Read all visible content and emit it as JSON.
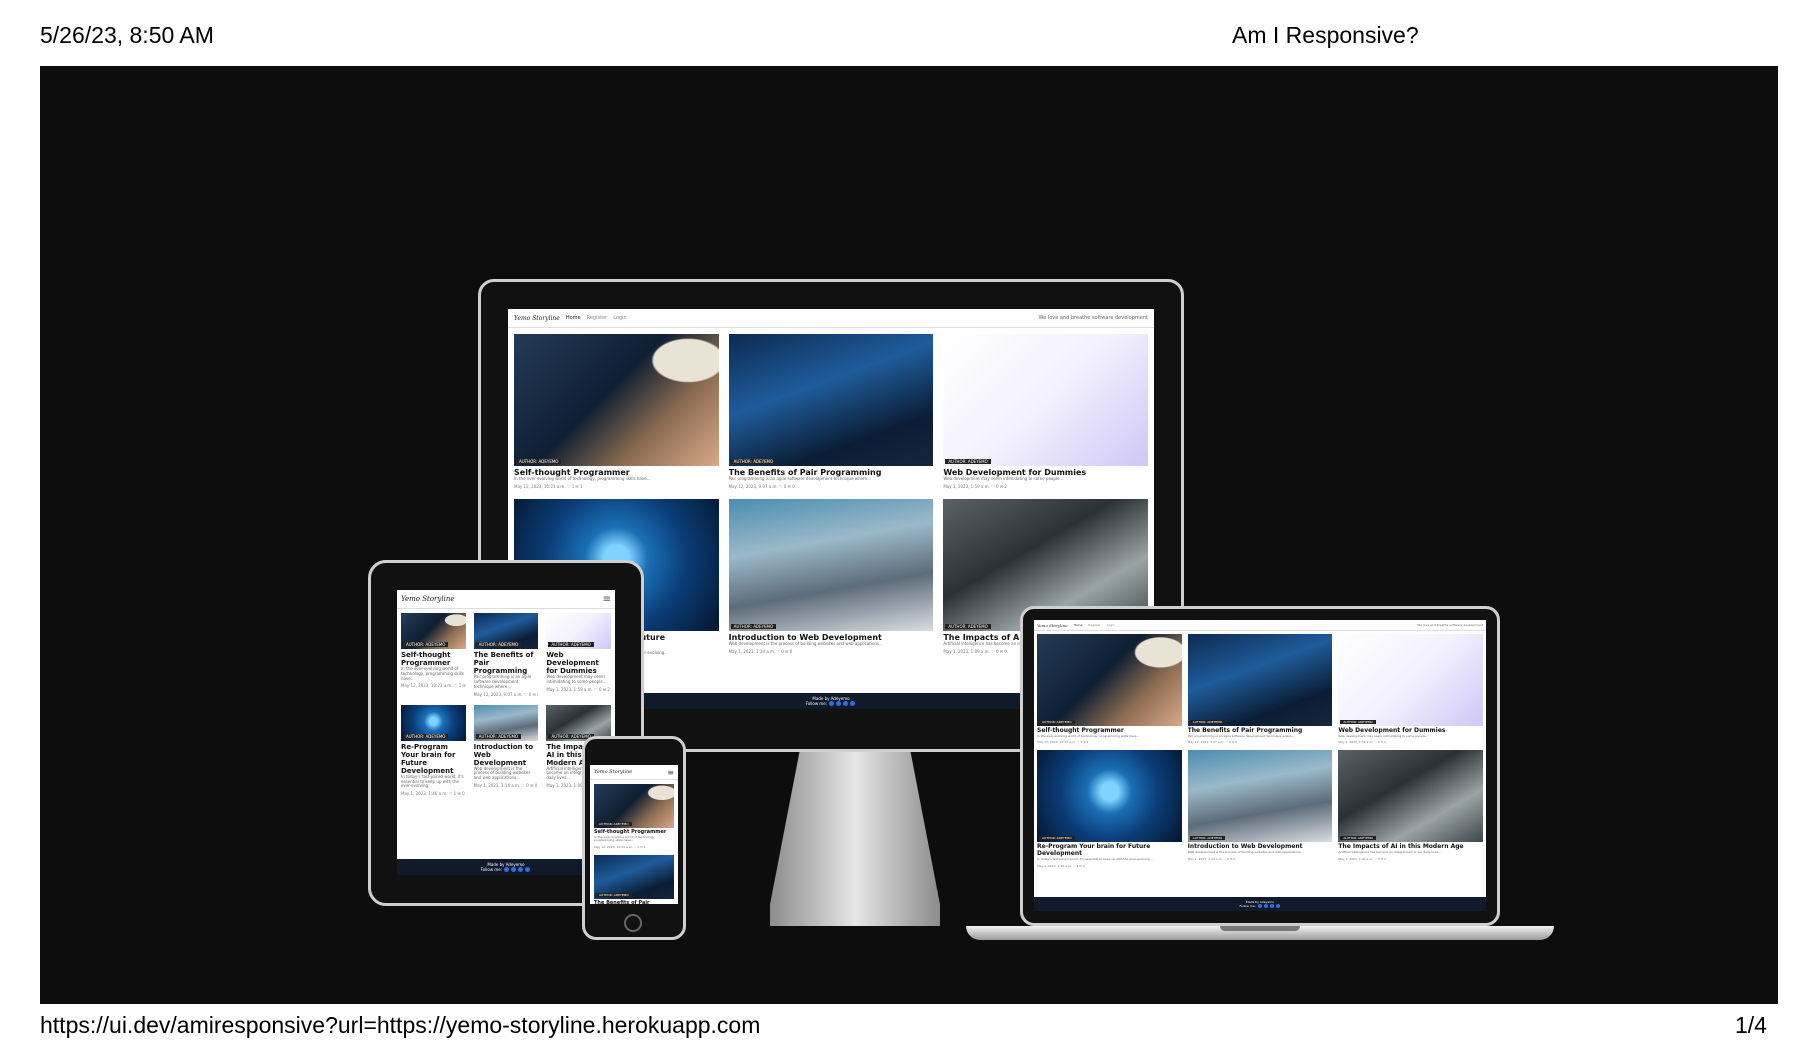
{
  "page_header": {
    "datetime": "5/26/23, 8:50 AM",
    "title": "Am I Responsive?"
  },
  "page_footer": {
    "url": "https://ui.dev/amiresponsive?url=https://yemo-storyline.herokuapp.com",
    "page_number": "1/4"
  },
  "site": {
    "logo": "Yemo Storyline",
    "nav": [
      "Home",
      "Register",
      "Login"
    ],
    "tagline": "We love and breathe software development",
    "footer_made_by": "Made by Adeyemo",
    "footer_follow": "Follow me:"
  },
  "posts": [
    {
      "title": "Self-thought Programmer",
      "badge": "AUTHOR: ADEYEMO",
      "excerpt": "In the ever-evolving world of technology, programming skills have...",
      "date": "May 12, 2023, 10:23 a.m.",
      "likes": "1",
      "comments": "1",
      "thumb": "laptop"
    },
    {
      "title": "The Benefits of Pair Programming",
      "badge": "AUTHOR: ADEYEMO",
      "excerpt": "Pair programming is an agile software development technique where...",
      "date": "May 12, 2023, 9:07 a.m.",
      "likes": "0",
      "comments": "0",
      "thumb": "pair"
    },
    {
      "title": "Web Development for Dummies",
      "badge": "AUTHOR: ADEYEMO",
      "excerpt": "Web development may seem intimidating to some people...",
      "date": "May 1, 2023, 1:59 a.m.",
      "likes": "0",
      "comments": "2",
      "thumb": "dummies"
    },
    {
      "title": "Re-Program Your brain for Future Development",
      "badge": "AUTHOR: ADEYEMO",
      "excerpt": "In today's fast-paced world, it's essential to keep up with the ever-evolving...",
      "date": "May 1, 2023, 1:46 a.m.",
      "likes": "1",
      "comments": "0",
      "thumb": "brain"
    },
    {
      "title": "Introduction to Web Development",
      "badge": "AUTHOR: ADEYEMO",
      "excerpt": "Web development is the process of building websites and web applications...",
      "date": "May 1, 2023, 1:14 a.m.",
      "likes": "0",
      "comments": "0",
      "thumb": "intro"
    },
    {
      "title": "The Impacts of AI in this Modern Age",
      "badge": "AUTHOR: ADEYEMO",
      "excerpt": "Artificial intelligence has become an integral part of our daily lives...",
      "date": "May 1, 2023, 1:09 a.m.",
      "likes": "0",
      "comments": "0",
      "thumb": "robot"
    }
  ],
  "colors": {
    "stage_background": "#0d0d0d",
    "site_footer": "#0f1a2b",
    "social_icon": "#2f6de0"
  }
}
